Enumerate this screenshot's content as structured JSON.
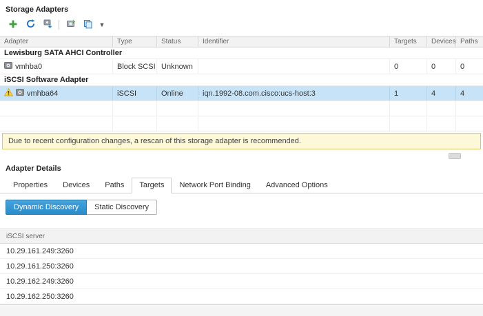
{
  "panel": {
    "title": "Storage Adapters"
  },
  "toolbar": {
    "icons": [
      "add-adapter",
      "refresh",
      "rescan-storage",
      "rescan-adapter",
      "copy"
    ]
  },
  "table": {
    "columns": [
      "Adapter",
      "Type",
      "Status",
      "Identifier",
      "Targets",
      "Devices",
      "Paths"
    ],
    "group1": "Lewisburg SATA AHCI Controller",
    "row1": {
      "adapter": "vmhba0",
      "type": "Block SCSI",
      "status": "Unknown",
      "identifier": "",
      "targets": "0",
      "devices": "0",
      "paths": "0"
    },
    "group2": "iSCSI Software Adapter",
    "row2": {
      "adapter": "vmhba64",
      "type": "iSCSI",
      "status": "Online",
      "identifier": "iqn.1992-08.com.cisco:ucs-host:3",
      "targets": "1",
      "devices": "4",
      "paths": "4"
    }
  },
  "banner": {
    "text": "Due to recent configuration changes, a rescan of this storage adapter is recommended."
  },
  "details": {
    "title": "Adapter Details",
    "tabs": [
      "Properties",
      "Devices",
      "Paths",
      "Targets",
      "Network Port Binding",
      "Advanced Options"
    ],
    "active_tab": "Targets",
    "discovery": [
      "Dynamic Discovery",
      "Static Discovery"
    ],
    "active_discovery": "Dynamic Discovery",
    "server_column": "iSCSI server",
    "servers": [
      "10.29.161.249:3260",
      "10.29.161.250:3260",
      "10.29.162.249:3260",
      "10.29.162.250:3260"
    ]
  },
  "colors": {
    "selection_blue": "#c7e3f7",
    "warning_bg": "#fcf8d8",
    "warning_border": "#d6c76a",
    "primary_blue": "#2f97d9",
    "add_green": "#3aa335"
  }
}
